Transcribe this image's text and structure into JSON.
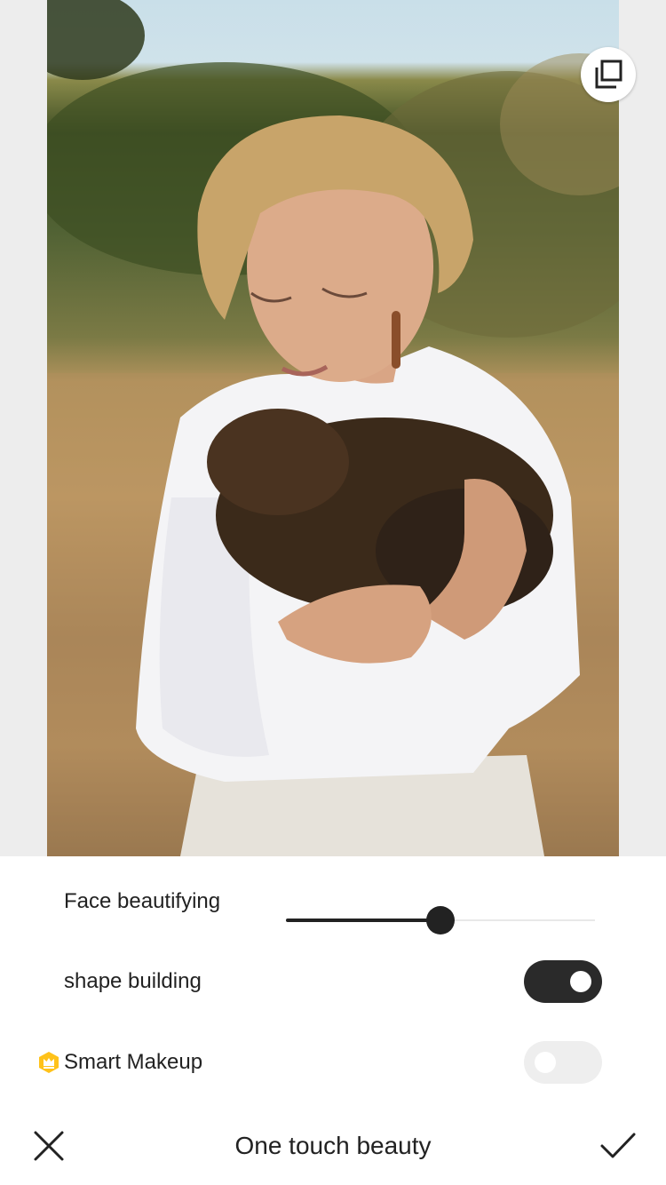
{
  "photo": {
    "compare_icon": "compare-layers-icon"
  },
  "controls": {
    "face_beautifying": {
      "label": "Face beautifying",
      "value": 0.5
    },
    "shape_building": {
      "label": "shape building",
      "enabled": true
    },
    "smart_makeup": {
      "label": "Smart Makeup",
      "enabled": false,
      "badge_icon": "crown-icon",
      "badge_color": "#FFC21A"
    }
  },
  "bottom_bar": {
    "title": "One touch beauty",
    "cancel_icon": "close-icon",
    "confirm_icon": "checkmark-icon"
  }
}
